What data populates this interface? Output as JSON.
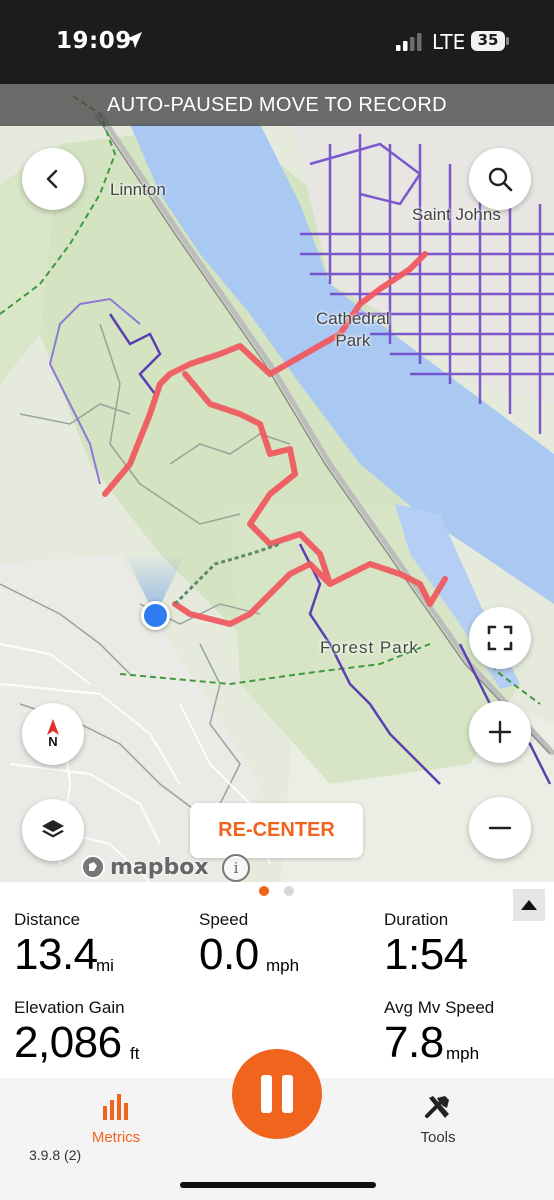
{
  "status_bar": {
    "time": "19:09",
    "network": "LTE",
    "battery": "35"
  },
  "banner": {
    "text": "AUTO-PAUSED MOVE TO RECORD"
  },
  "map": {
    "labels": {
      "linnton": "Linnton",
      "saint_johns": "Saint Johns",
      "cathedral_line1": "Cathedral",
      "cathedral_line2": "Park",
      "forest_park": "Forest Park"
    },
    "recenter_label": "RE-CENTER",
    "attribution": "mapbox",
    "info_glyph": "i",
    "compass_letter": "N",
    "colors": {
      "route": "#ef5a5f",
      "water": "#a9c8f2",
      "park": "#d4e3c2",
      "heatmap": "#6b3fc9",
      "location": "#2f7cf0"
    }
  },
  "pager": {
    "active_index": 0,
    "count": 2
  },
  "metrics": {
    "distance": {
      "label": "Distance",
      "value": "13.4",
      "unit": "mi"
    },
    "speed": {
      "label": "Speed",
      "value": "0.0",
      "unit": "mph"
    },
    "duration": {
      "label": "Duration",
      "value": "1:54"
    },
    "elevation_gain": {
      "label": "Elevation Gain",
      "value": "2,086",
      "unit": "ft"
    },
    "avg_moving_speed": {
      "label": "Avg Mv Speed",
      "value": "7.8",
      "unit": "mph"
    }
  },
  "tabbar": {
    "metrics_label": "Metrics",
    "tools_label": "Tools",
    "version": "3.9.8 (2)",
    "accent": "#f0641e"
  }
}
